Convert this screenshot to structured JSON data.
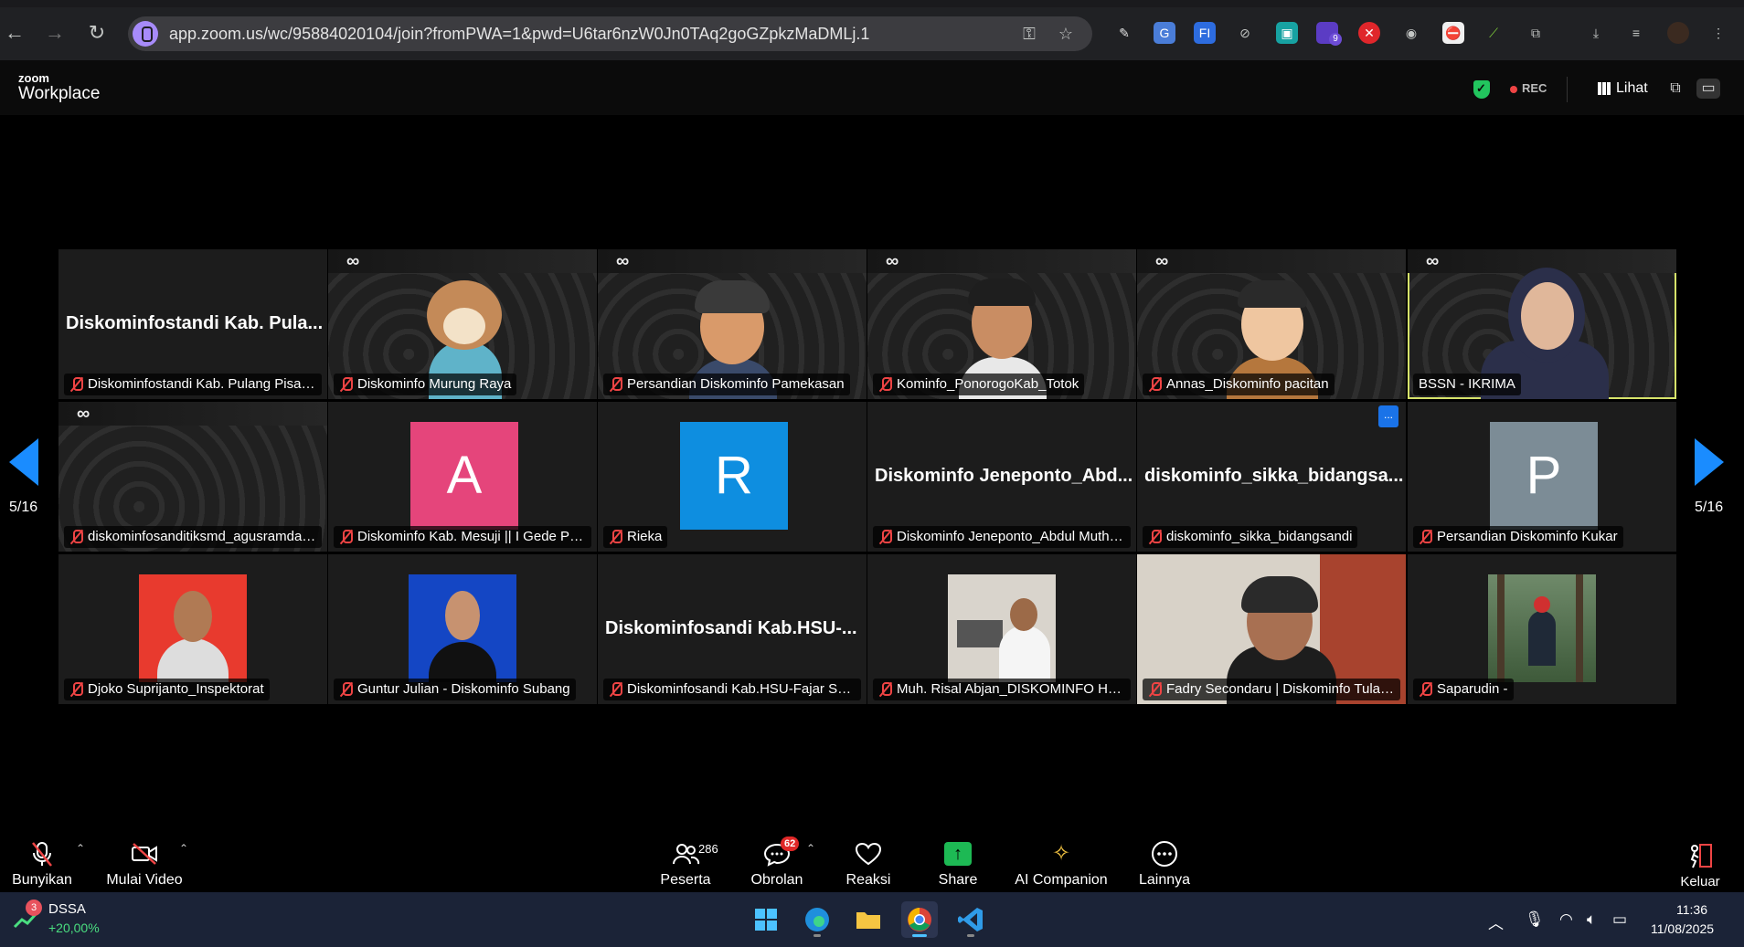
{
  "browser": {
    "url": "app.zoom.us/wc/95884020104/join?fromPWA=1&pwd=U6tar6nzW0Jn0TAq2goGZpkzMaDMLj.1",
    "extension_badge": "9"
  },
  "zoom_header": {
    "logo_small": "zoom",
    "logo_big": "Workplace",
    "rec_label": "REC",
    "view_label": "Lihat"
  },
  "gallery": {
    "page_left": "5/16",
    "page_right": "5/16",
    "more_button": "...",
    "rows": [
      [
        {
          "label": "Diskominfostandi Kab. Pulang Pisau_...",
          "big_name": "Diskominfostandi Kab. Pula..."
        },
        {
          "label": "Diskominfo Murung Raya"
        },
        {
          "label": "Persandian Diskominfo Pamekasan"
        },
        {
          "label": "Kominfo_PonorogoKab_Totok"
        },
        {
          "label": "Annas_Diskominfo pacitan"
        },
        {
          "label": "BSSN - IKRIMA"
        }
      ],
      [
        {
          "label": "diskominfosanditiksmd_agusramdans"
        },
        {
          "label": "Diskominfo Kab. Mesuji || I Gede Put...",
          "letter": "A",
          "color": "#e5457b"
        },
        {
          "label": "Rieka",
          "letter": "R",
          "color": "#0e8ee0"
        },
        {
          "label": "Diskominfo Jeneponto_Abdul Mutho...",
          "big_name": "Diskominfo Jeneponto_Abd..."
        },
        {
          "label": "diskominfo_sikka_bidangsandi",
          "big_name": "diskominfo_sikka_bidangsa..."
        },
        {
          "label": "Persandian Diskominfo Kukar",
          "letter": "P",
          "color": "#7c8c96"
        }
      ],
      [
        {
          "label": "Djoko Suprijanto_Inspektorat"
        },
        {
          "label": "Guntur Julian - Diskominfo Subang"
        },
        {
          "label": "Diskominfosandi Kab.HSU-Fajar Sya'...",
          "big_name": "Diskominfosandi Kab.HSU-..."
        },
        {
          "label": "Muh. Risal Abjan_DISKOMINFO HAL..."
        },
        {
          "label": "Fadry Secondaru | Diskominfo Tulang..."
        },
        {
          "label": "Saparudin -"
        }
      ]
    ]
  },
  "toolbar": {
    "unmute": "Bunyikan",
    "start_video": "Mulai Video",
    "participants": "Peserta",
    "participants_count": "286",
    "chat": "Obrolan",
    "chat_badge": "62",
    "reactions": "Reaksi",
    "share": "Share",
    "ai_companion": "AI Companion",
    "more": "Lainnya",
    "leave": "Keluar"
  },
  "taskbar": {
    "stock_badge": "3",
    "stock_name": "DSSA",
    "stock_change": "+20,00%",
    "time": "11:36",
    "date": "11/08/2025"
  },
  "colors": {
    "accent_blue": "#1a8cff",
    "speaker_outline": "#d6e36a",
    "share_green": "#1db954",
    "mute_red": "#ef4444"
  }
}
